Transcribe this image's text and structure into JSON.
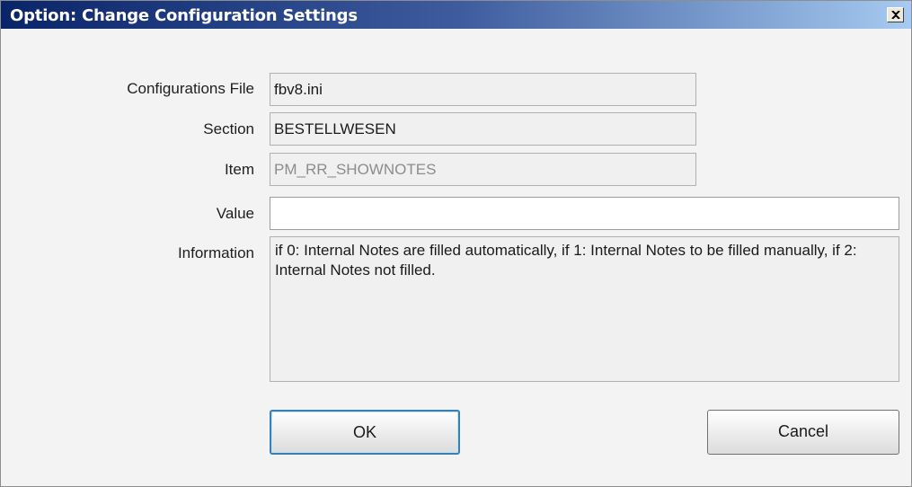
{
  "window": {
    "title": "Option: Change Configuration Settings",
    "close_label": "close"
  },
  "form": {
    "config_file": {
      "label": "Configurations File",
      "value": "fbv8.ini"
    },
    "section": {
      "label": "Section",
      "value": "BESTELLWESEN"
    },
    "item": {
      "label": "Item",
      "value": "PM_RR_SHOWNOTES"
    },
    "value": {
      "label": "Value",
      "value": ""
    },
    "information": {
      "label": "Information",
      "text": "if 0: Internal Notes are filled automatically, if 1: Internal Notes to be filled manually, if 2: Internal Notes not filled."
    }
  },
  "buttons": {
    "ok_label": "OK",
    "cancel_label": "Cancel"
  }
}
